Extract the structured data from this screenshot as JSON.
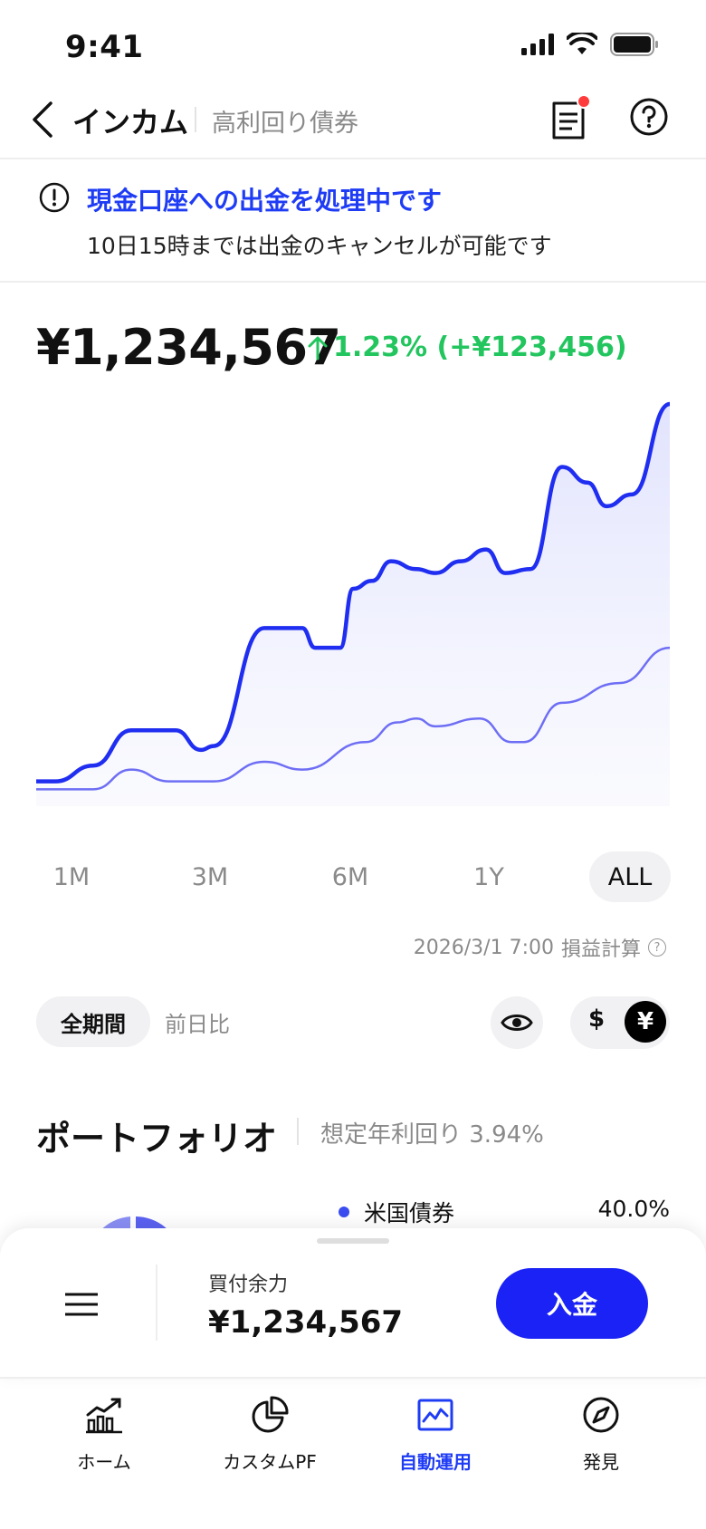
{
  "status": {
    "time": "9:41"
  },
  "nav": {
    "title": "インカム",
    "subtitle": "高利回り債券"
  },
  "banner": {
    "title": "現金口座への出金を処理中です",
    "text": "10日15時までは出金のキャンセルが可能です"
  },
  "balance": {
    "value": "¥1,234,567",
    "change": "1.23% (+¥123,456)",
    "change_color": "#22c55e"
  },
  "chart_data": {
    "type": "area",
    "x_range": [
      0,
      1
    ],
    "y_range": [
      0,
      1
    ],
    "grid": false,
    "series": [
      {
        "values": [
          [
            0,
            0.04
          ],
          [
            0.03,
            0.04
          ],
          [
            0.09,
            0.08
          ],
          [
            0.15,
            0.17
          ],
          [
            0.22,
            0.17
          ],
          [
            0.26,
            0.12
          ],
          [
            0.28,
            0.13
          ],
          [
            0.36,
            0.43
          ],
          [
            0.42,
            0.43
          ],
          [
            0.44,
            0.38
          ],
          [
            0.48,
            0.38
          ],
          [
            0.5,
            0.53
          ],
          [
            0.53,
            0.55
          ],
          [
            0.56,
            0.6
          ],
          [
            0.6,
            0.58
          ],
          [
            0.63,
            0.57
          ],
          [
            0.67,
            0.6
          ],
          [
            0.71,
            0.63
          ],
          [
            0.74,
            0.57
          ],
          [
            0.78,
            0.58
          ],
          [
            0.83,
            0.84
          ],
          [
            0.87,
            0.8
          ],
          [
            0.9,
            0.74
          ],
          [
            0.94,
            0.77
          ],
          [
            1,
            1.0
          ]
        ],
        "color": "#1f2ef0",
        "fill": true
      },
      {
        "values": [
          [
            0,
            0.02
          ],
          [
            0.09,
            0.02
          ],
          [
            0.15,
            0.07
          ],
          [
            0.21,
            0.04
          ],
          [
            0.28,
            0.04
          ],
          [
            0.36,
            0.09
          ],
          [
            0.42,
            0.07
          ],
          [
            0.52,
            0.14
          ],
          [
            0.57,
            0.19
          ],
          [
            0.6,
            0.2
          ],
          [
            0.63,
            0.18
          ],
          [
            0.7,
            0.2
          ],
          [
            0.75,
            0.14
          ],
          [
            0.77,
            0.14
          ],
          [
            0.83,
            0.24
          ],
          [
            0.92,
            0.29
          ],
          [
            1,
            0.38
          ]
        ],
        "color": "#6e6ef5",
        "fill": false
      }
    ]
  },
  "periods": [
    "1M",
    "3M",
    "6M",
    "1Y",
    "ALL"
  ],
  "active_period": "ALL",
  "timestamp": {
    "text": "2026/3/1 7:00",
    "label": "損益計算",
    "q": "?"
  },
  "segment": {
    "all": "全期間",
    "prev": "前日比"
  },
  "currency": {
    "usd": "$",
    "jpy": "¥"
  },
  "portfolio": {
    "title": "ポートフォリオ",
    "yield": "想定年利回り 3.94%",
    "items": [
      {
        "name": "米国債券",
        "value": "40.0%",
        "color": "#3b4cf0"
      }
    ]
  },
  "sheet": {
    "label": "買付余力",
    "value": "¥1,234,567",
    "deposit": "入金"
  },
  "tabs": [
    {
      "label": "ホーム"
    },
    {
      "label": "カスタムPF"
    },
    {
      "label": "自動運用"
    },
    {
      "label": "発見"
    }
  ]
}
